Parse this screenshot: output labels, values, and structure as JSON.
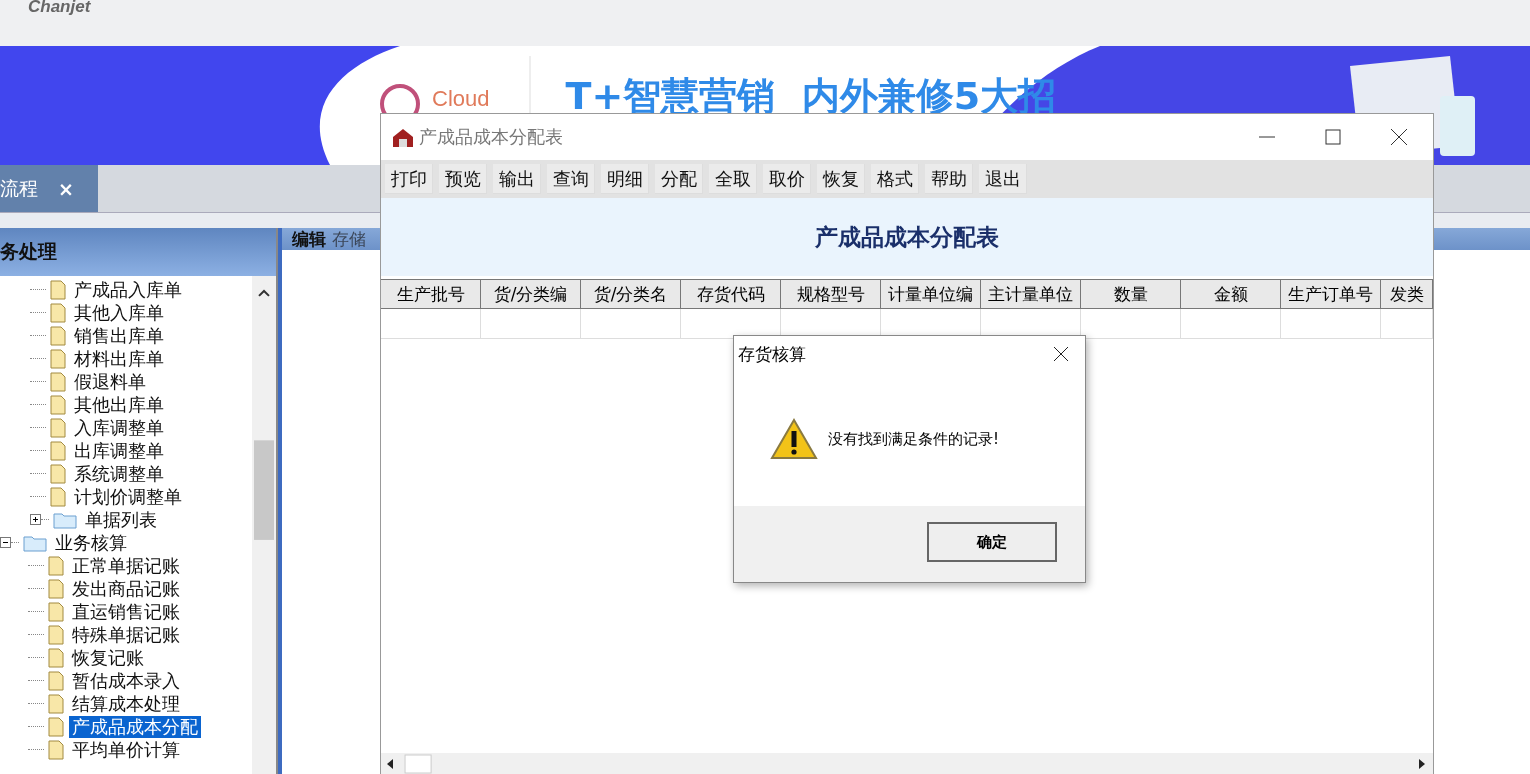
{
  "header": {
    "logo": "Chanjet"
  },
  "banner": {
    "cloud_label": "Cloud",
    "headline": "T+智慧营销  内外兼修5大招"
  },
  "tabs": [
    {
      "label": "流程",
      "selected": true,
      "close": "×"
    }
  ],
  "sidebar": {
    "title": "务处理",
    "tree": [
      {
        "kind": "group",
        "children": [
          {
            "label": "产成品入库单",
            "kind": "doc",
            "selected": false
          },
          {
            "label": "其他入库单",
            "kind": "doc",
            "selected": false
          },
          {
            "label": "销售出库单",
            "kind": "doc",
            "selected": false
          },
          {
            "label": "材料出库单",
            "kind": "doc",
            "selected": false
          },
          {
            "label": "假退料单",
            "kind": "doc",
            "selected": false
          },
          {
            "label": "其他出库单",
            "kind": "doc",
            "selected": false
          },
          {
            "label": "入库调整单",
            "kind": "doc",
            "selected": false
          },
          {
            "label": "出库调整单",
            "kind": "doc",
            "selected": false
          },
          {
            "label": "系统调整单",
            "kind": "doc",
            "selected": false
          },
          {
            "label": "计划价调整单",
            "kind": "doc",
            "selected": false
          },
          {
            "label": "单据列表",
            "kind": "folder",
            "expanded": false,
            "selected": false
          }
        ]
      },
      {
        "label": "业务核算",
        "kind": "folder",
        "expanded": true,
        "selected": false,
        "children": [
          {
            "label": "正常单据记账",
            "kind": "doc",
            "selected": false
          },
          {
            "label": "发出商品记账",
            "kind": "doc",
            "selected": false
          },
          {
            "label": "直运销售记账",
            "kind": "doc",
            "selected": false
          },
          {
            "label": "特殊单据记账",
            "kind": "doc",
            "selected": false
          },
          {
            "label": "恢复记账",
            "kind": "doc",
            "selected": false
          },
          {
            "label": "暂估成本录入",
            "kind": "doc",
            "selected": false
          },
          {
            "label": "结算成本处理",
            "kind": "doc",
            "selected": false
          },
          {
            "label": "产成品成本分配",
            "kind": "doc",
            "selected": true
          },
          {
            "label": "平均单价计算",
            "kind": "doc",
            "selected": false
          }
        ]
      }
    ]
  },
  "workspace": {
    "menu": [
      {
        "label": "编辑",
        "disabled": false
      },
      {
        "label": "存储",
        "disabled": true
      }
    ]
  },
  "report_window": {
    "title": "产成品成本分配表",
    "toolbar": [
      "打印",
      "预览",
      "输出",
      "查询",
      "明细",
      "分配",
      "全取",
      "取价",
      "恢复",
      "格式",
      "帮助",
      "退出"
    ],
    "heading": "产成品成本分配表",
    "columns": [
      "生产批号",
      "货/分类编",
      "货/分类名",
      "存货代码",
      "规格型号",
      "计量单位编",
      "主计量单位",
      "数量",
      "金额",
      "生产订单号",
      "发类"
    ]
  },
  "dialog": {
    "title": "存货核算",
    "message": "没有找到满足条件的记录!",
    "button": "确定"
  }
}
